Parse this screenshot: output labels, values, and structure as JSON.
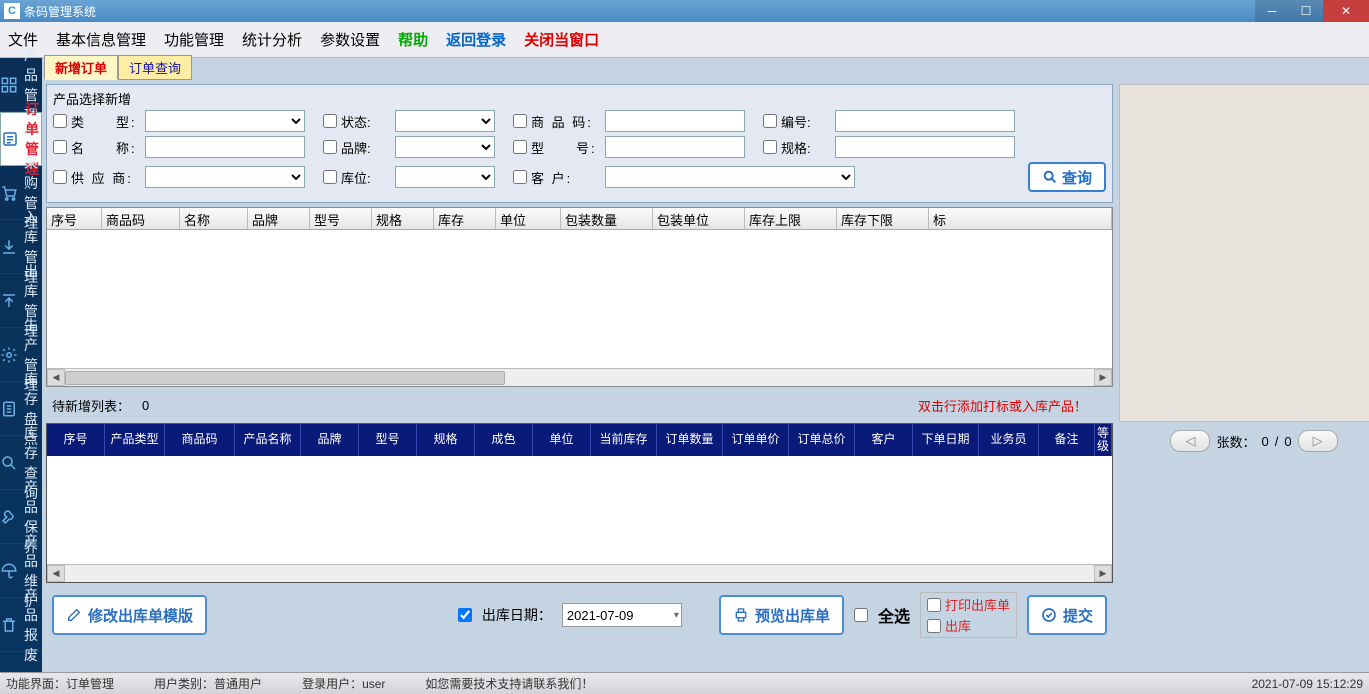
{
  "window": {
    "title": "条码管理系统"
  },
  "menu": {
    "file": "文件",
    "basic": "基本信息管理",
    "func": "功能管理",
    "stat": "统计分析",
    "param": "参数设置",
    "help": "帮助",
    "relogin": "返回登录",
    "closewin": "关闭当窗口"
  },
  "sidebar": {
    "items": [
      {
        "label": "产品管理"
      },
      {
        "label": "订单管理"
      },
      {
        "label": "采购管理"
      },
      {
        "label": "入库管理"
      },
      {
        "label": "出库管理"
      },
      {
        "label": "生产管理"
      },
      {
        "label": "库存盘点"
      },
      {
        "label": "库存查询"
      },
      {
        "label": "产品保养"
      },
      {
        "label": "产品维护"
      },
      {
        "label": "产品报废"
      }
    ]
  },
  "tabs": {
    "new_order": "新增订单",
    "query_order": "订单查询"
  },
  "filter": {
    "legend": "产品选择新增",
    "type": "类　　型:",
    "status": "状态:",
    "code": "商 品 码:",
    "no": "编号:",
    "name": "名　　称:",
    "brand": "品牌:",
    "model": "型　　号:",
    "spec": "规格:",
    "supplier": "供 应 商:",
    "whpos": "库位:",
    "customer": "客 户:",
    "search": "查询"
  },
  "grid1": {
    "cols": [
      "序号",
      "商品码",
      "名称",
      "品牌",
      "型号",
      "规格",
      "库存",
      "单位",
      "包装数量",
      "包装单位",
      "库存上限",
      "库存下限",
      "标"
    ]
  },
  "midbar": {
    "label": "待新增列表：",
    "count": "0",
    "hint": "双击行添加打标或入库产品！",
    "pages_label": "张数：",
    "pages_cur": "0",
    "pages_sep": " / ",
    "pages_total": "0"
  },
  "grid2": {
    "cols": [
      "序号",
      "产品类型",
      "商品码",
      "产品名称",
      "品牌",
      "型号",
      "规格",
      "成色",
      "单位",
      "当前库存",
      "订单数量",
      "订单单价",
      "订单总价",
      "客户",
      "下单日期",
      "业务员",
      "备注",
      "等级"
    ]
  },
  "actions": {
    "modify_template": "修改出库单模版",
    "out_date_label": "出库日期：",
    "out_date_value": "2021-07-09",
    "preview": "预览出库单",
    "select_all": "全选",
    "print_out": "打印出库单",
    "do_out": "出库",
    "submit": "提交"
  },
  "status": {
    "view_label": "功能界面：",
    "view_value": "订单管理",
    "utype_label": "用户类别：",
    "utype_value": "普通用户",
    "login_label": "登录用户：",
    "login_value": "user",
    "support": "如您需要技术支持请联系我们！",
    "datetime": "2021-07-09 15:12:29"
  }
}
